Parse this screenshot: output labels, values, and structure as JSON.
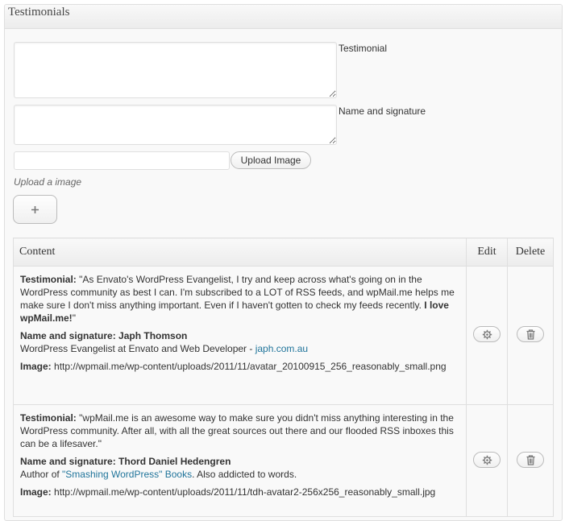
{
  "panel": {
    "title": "Testimonials"
  },
  "form": {
    "testimonial_label": "Testimonial",
    "testimonial_value": "",
    "name_label": "Name and signature",
    "name_value": "",
    "image_url_value": "",
    "upload_button_label": "Upload Image",
    "upload_hint": "Upload a image",
    "add_button_icon": "plus-icon"
  },
  "table": {
    "columns": {
      "content": "Content",
      "edit": "Edit",
      "delete": "Delete"
    },
    "rows": [
      {
        "testimonial_label": "Testimonial:",
        "testimonial_text": "\"As Envato's WordPress Evangelist, I try and keep across what's going on in the WordPress community as best I can. I'm subscribed to a LOT of RSS feeds, and wpMail.me helps me make sure I don't miss anything important. Even if I haven't gotten to check my feeds recently.",
        "testimonial_bold": "I love wpMail.me!",
        "testimonial_end": "\"",
        "name_label": "Name and signature:",
        "name": "Japh Thomson",
        "signature_text": "WordPress Evangelist at Envato and Web Developer -",
        "signature_link": "japh.com.au",
        "signature_after": "",
        "image_label": "Image:",
        "image_url": "http://wpmail.me/wp-content/uploads/2011/11/avatar_20100915_256_reasonably_small.png",
        "edit_icon": "gear-icon",
        "delete_icon": "trash-icon"
      },
      {
        "testimonial_label": "Testimonial:",
        "testimonial_text": "\"wpMail.me is an awesome way to make sure you didn't miss anything interesting in the WordPress community. After all, with all the great sources out there and our flooded RSS inboxes this can be a lifesaver.\"",
        "testimonial_bold": "",
        "testimonial_end": "",
        "name_label": "Name and signature:",
        "name": "Thord Daniel Hedengren",
        "signature_text": "Author of",
        "signature_link": "\"Smashing WordPress\" Books",
        "signature_after": ". Also addicted to words.",
        "image_label": "Image:",
        "image_url": "http://wpmail.me/wp-content/uploads/2011/11/tdh-avatar2-256x256_reasonably_small.jpg",
        "edit_icon": "gear-icon",
        "delete_icon": "trash-icon"
      }
    ]
  },
  "colors": {
    "link": "#21759b",
    "border": "#dfdfdf",
    "panel_bg": "#f9f9f9"
  }
}
